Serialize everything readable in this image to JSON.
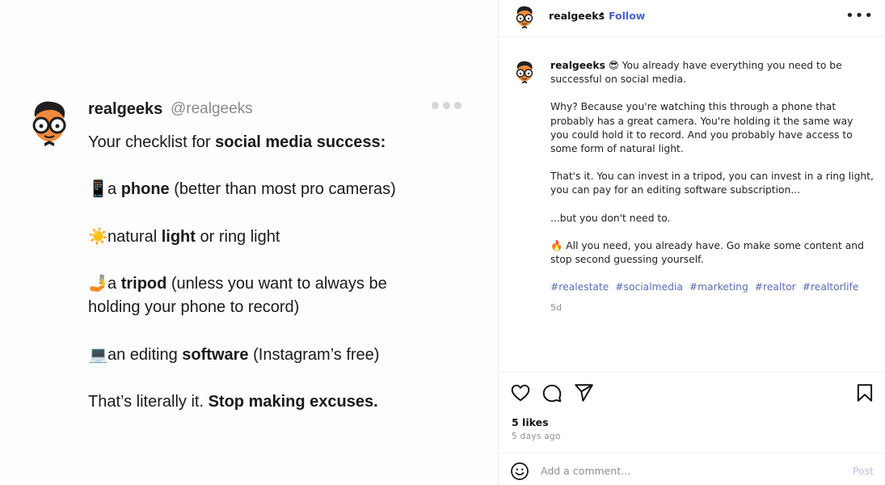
{
  "image_post": {
    "name": "realgeeks",
    "handle": "@realgeeks",
    "headline_prefix": "Your checklist for ",
    "headline_bold": "social media success:",
    "items": [
      {
        "emoji": "📱",
        "pre": "a ",
        "bold": "phone",
        "post": " (better than most pro cameras)"
      },
      {
        "emoji": "☀️",
        "pre": "natural ",
        "bold": "light",
        "post": " or ring light"
      },
      {
        "emoji": "🤳",
        "pre": "a ",
        "bold": "tripod",
        "post": " (unless you want to always be",
        "post2": "holding your phone to record)"
      },
      {
        "emoji": "💻",
        "pre": "an editing ",
        "bold": "software",
        "post": " (Instagram’s free)"
      }
    ],
    "closing_pre": "That’s literally it. ",
    "closing_bold": "Stop making excuses."
  },
  "header": {
    "username": "realgeeks",
    "separator": "•",
    "follow_label": "Follow",
    "more_label": "•••"
  },
  "caption": {
    "username": "realgeeks",
    "emoji": "😎",
    "p1": "You already have everything you need to be successful on social media.",
    "p2": "Why? Because you're watching this through a phone that probably has a great camera. You're holding it the same way you could hold it to record. And you probably have access to some form of natural light.",
    "p3": "That's it. You can invest in a tripod, you can invest in a ring light, you can pay for an editing software subscription...",
    "p4": "...but you don't need to.",
    "p5_emoji": "🔥",
    "p5": "All you need, you already have. Go make some content and stop second guessing yourself.",
    "hashtags": [
      "#realestate",
      "#socialmedia",
      "#marketing",
      "#realtor",
      "#realtorlife"
    ],
    "time": "5d"
  },
  "engagement": {
    "likes": "5 likes",
    "posted_ago": "5 days ago"
  },
  "comment": {
    "placeholder": "Add a comment...",
    "post_label": "Post"
  },
  "icons": [
    "heart-icon",
    "comment-icon",
    "share-icon",
    "bookmark-icon",
    "emoji-icon",
    "more-icon"
  ],
  "colors": {
    "follow": "#4a5fd0",
    "hashtag": "#5b6ab8",
    "post_disabled": "#b8c4e6"
  }
}
